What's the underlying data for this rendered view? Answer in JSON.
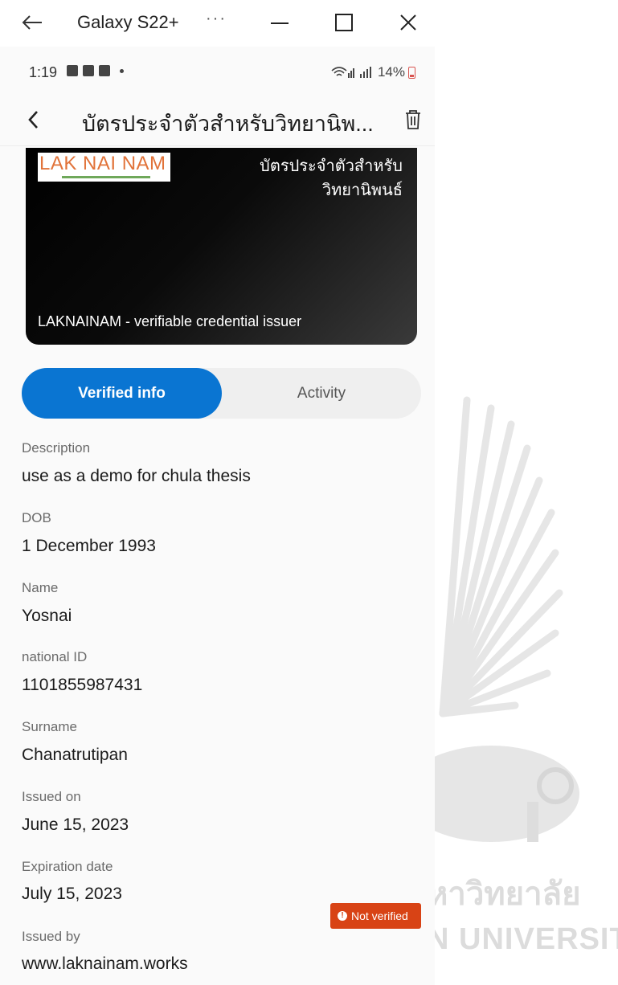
{
  "window": {
    "title": "Galaxy S22+",
    "more_label": "···"
  },
  "statusbar": {
    "time": "1:19",
    "battery": "14%"
  },
  "appbar": {
    "title": "บัตรประจำตัวสำหรับวิทยานิพ..."
  },
  "card": {
    "logo_text": "LAK NAI NAM",
    "title_line1": "บัตรประจำตัวสำหรับ",
    "title_line2": "วิทยานิพนธ์",
    "issuer": "LAKNAINAM - verifiable credential issuer",
    "colors": {
      "bg": "#000000",
      "logo": "#e1733a"
    }
  },
  "tabs": {
    "active": "Verified info",
    "inactive": "Activity",
    "accent": "#0a75d2"
  },
  "fields": [
    {
      "label": "Description",
      "value": "use as a demo for chula thesis"
    },
    {
      "label": "DOB",
      "value": "1 December 1993"
    },
    {
      "label": "Name",
      "value": "Yosnai"
    },
    {
      "label": "national ID",
      "value": "1101855987431"
    },
    {
      "label": "Surname",
      "value": "Chanatrutipan"
    },
    {
      "label": "Issued on",
      "value": "June 15, 2023"
    },
    {
      "label": "Expiration date",
      "value": "July 15, 2023"
    },
    {
      "label": "Issued by",
      "value": "www.laknainam.works"
    }
  ],
  "badge": {
    "label": "Not verified",
    "color": "#d84315"
  },
  "watermark": {
    "thai": "หาวิทยาลัย",
    "english": "N UNIVERSITY"
  }
}
